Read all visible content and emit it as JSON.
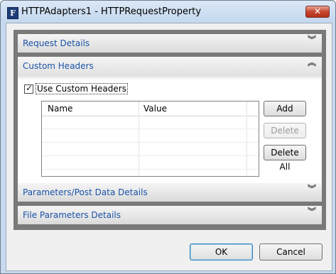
{
  "window": {
    "title": "HTTPAdapters1 - HTTPRequestProperty",
    "app_icon_letter": "F",
    "close_glyph": "✕"
  },
  "sections": [
    {
      "title": "Request Details",
      "state": "collapsed"
    },
    {
      "title": "Custom Headers",
      "state": "expanded"
    },
    {
      "title": "Parameters/Post Data Details",
      "state": "collapsed"
    },
    {
      "title": "File Parameters Details",
      "state": "collapsed"
    }
  ],
  "custom_headers": {
    "checkbox_label": "Use Custom Headers",
    "checkbox_checked": true,
    "check_glyph": "✓",
    "columns": [
      "Name",
      "Value"
    ],
    "rows": [],
    "buttons": {
      "add": "Add",
      "delete": "Delete",
      "delete_all": "Delete All"
    }
  },
  "chevrons": {
    "down": "︾",
    "up": "︽"
  },
  "footer": {
    "ok": "OK",
    "cancel": "Cancel"
  }
}
